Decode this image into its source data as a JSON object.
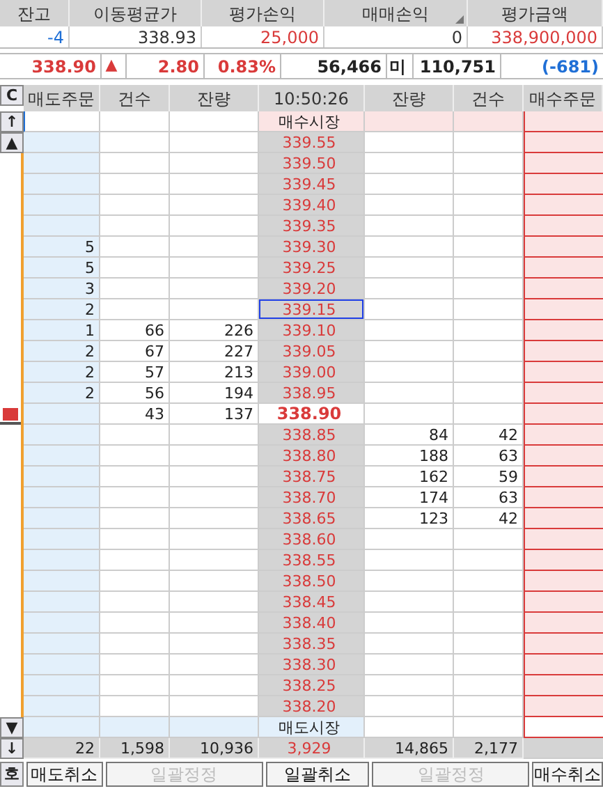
{
  "summary": {
    "columns": [
      "잔고",
      "이동평균가",
      "평가손익",
      "매매손익",
      "평가금액"
    ],
    "values": [
      {
        "text": "-4",
        "color": "#1f6fd6"
      },
      {
        "text": "338.93",
        "color": "#333333"
      },
      {
        "text": "25,000",
        "color": "#d93a3a"
      },
      {
        "text": "0",
        "color": "#333333"
      },
      {
        "text": "338,900,000",
        "color": "#d93a3a"
      }
    ]
  },
  "quote": {
    "price": "338.90",
    "change_sign": "▲",
    "change": "2.80",
    "rate": "0.83%",
    "volume": "56,466",
    "open_interest_label": "미",
    "open_interest": "110,751",
    "open_interest_change": "(-681)"
  },
  "side_buttons": [
    "C",
    "↑",
    "▲",
    "▼",
    "↓",
    "호"
  ],
  "orderbook": {
    "columns": [
      "매도주문",
      "건수",
      "잔량",
      "10:50:26",
      "잔량",
      "건수",
      "매수주문"
    ],
    "market_buy": "매수시장",
    "asks": [
      {
        "price": "339.55",
        "selected": false
      },
      {
        "price": "339.50",
        "selected": false
      },
      {
        "price": "339.45",
        "selected": false
      },
      {
        "price": "339.40",
        "selected": false
      },
      {
        "price": "339.35",
        "selected": false
      },
      {
        "price": "339.30",
        "sell_order": "5",
        "selected": false
      },
      {
        "price": "339.25",
        "sell_order": "5",
        "selected": false
      },
      {
        "price": "339.20",
        "sell_order": "3",
        "selected": false
      },
      {
        "price": "339.15",
        "sell_order": "2",
        "selected": true
      },
      {
        "price": "339.10",
        "sell_order": "1",
        "count": "66",
        "qty": "226",
        "selected": false
      },
      {
        "price": "339.05",
        "sell_order": "2",
        "count": "67",
        "qty": "227",
        "selected": false
      },
      {
        "price": "339.00",
        "sell_order": "2",
        "count": "57",
        "qty": "213",
        "selected": false
      },
      {
        "price": "338.95",
        "sell_order": "2",
        "count": "56",
        "qty": "194",
        "selected": false
      }
    ],
    "current": {
      "price": "338.90",
      "count": "43",
      "qty": "137"
    },
    "bids": [
      {
        "price": "338.85",
        "qty": "84",
        "count": "42"
      },
      {
        "price": "338.80",
        "qty": "188",
        "count": "63"
      },
      {
        "price": "338.75",
        "qty": "162",
        "count": "59"
      },
      {
        "price": "338.70",
        "qty": "174",
        "count": "63"
      },
      {
        "price": "338.65",
        "qty": "123",
        "count": "42"
      },
      {
        "price": "338.60"
      },
      {
        "price": "338.55"
      },
      {
        "price": "338.50"
      },
      {
        "price": "338.45"
      },
      {
        "price": "338.40"
      },
      {
        "price": "338.35"
      },
      {
        "price": "338.30"
      },
      {
        "price": "338.25"
      },
      {
        "price": "338.20"
      }
    ],
    "market_sell": "매도시장",
    "totals": [
      "22",
      "1,598",
      "10,936",
      "3,929",
      "14,865",
      "2,177"
    ]
  },
  "buttons": [
    {
      "label": "매도취소",
      "disabled": false
    },
    {
      "label": "일괄정정",
      "disabled": true
    },
    {
      "label": "일괄취소",
      "disabled": false
    },
    {
      "label": "일괄정정",
      "disabled": true
    },
    {
      "label": "매수취소",
      "disabled": false
    }
  ]
}
